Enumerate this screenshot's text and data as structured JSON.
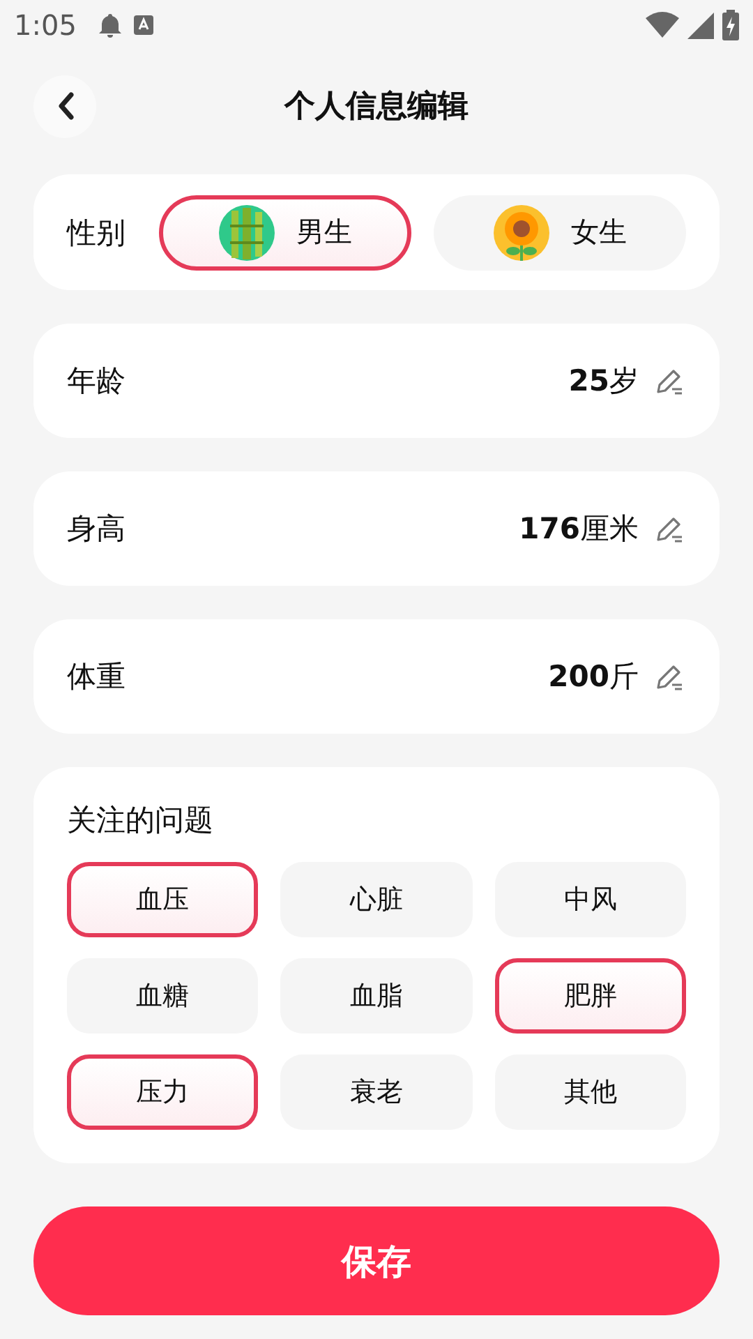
{
  "status_bar": {
    "time": "1:05"
  },
  "header": {
    "title": "个人信息编辑"
  },
  "gender": {
    "label": "性别",
    "options": [
      {
        "label": "男生",
        "kind": "bamboo",
        "selected": true
      },
      {
        "label": "女生",
        "kind": "sunflower",
        "selected": false
      }
    ]
  },
  "fields": [
    {
      "label": "年龄",
      "value": "**25**岁"
    },
    {
      "label": "身高",
      "value": "**176**厘米"
    },
    {
      "label": "体重",
      "value": "**200**斤"
    }
  ],
  "concerns": {
    "title": "关注的问题",
    "options": [
      {
        "label": "血压",
        "selected": true
      },
      {
        "label": "心脏",
        "selected": false
      },
      {
        "label": "中风",
        "selected": false
      },
      {
        "label": "血糖",
        "selected": false
      },
      {
        "label": "血脂",
        "selected": false
      },
      {
        "label": "肥胖",
        "selected": true
      },
      {
        "label": "压力",
        "selected": true
      },
      {
        "label": "衰老",
        "selected": false
      },
      {
        "label": "其他",
        "selected": false
      }
    ]
  },
  "save_button": {
    "label": "保存"
  }
}
